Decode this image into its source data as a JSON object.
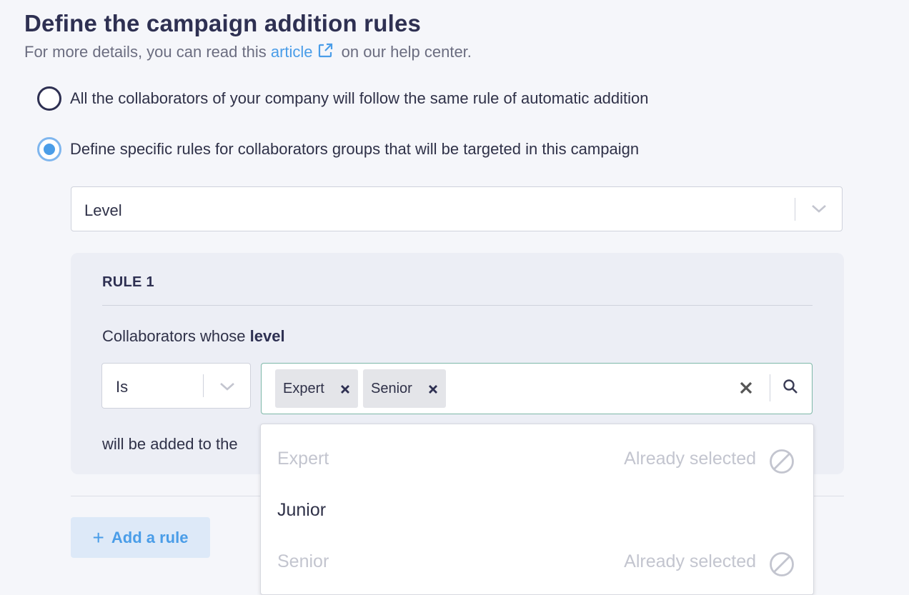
{
  "header": {
    "title": "Define the campaign addition rules",
    "subtitle_before": "For more details, you can read this",
    "link_text": "article",
    "subtitle_after": "on our help center."
  },
  "radios": {
    "same_rule_label": "All the collaborators of your company will follow the same rule of automatic addition",
    "specific_rules_label": "Define specific rules for collaborators groups that will be targeted in this campaign",
    "selected": "specific_rules"
  },
  "group_select": {
    "value": "Level"
  },
  "rule": {
    "title": "RULE 1",
    "collab_prefix": "Collaborators whose",
    "collab_field": "level",
    "operator": "Is",
    "chips": [
      "Expert",
      "Senior"
    ],
    "added_text": "will be added to the"
  },
  "dropdown": {
    "options": [
      {
        "label": "Expert",
        "note": "Already selected",
        "disabled": true
      },
      {
        "label": "Junior",
        "note": "",
        "disabled": false
      },
      {
        "label": "Senior",
        "note": "Already selected",
        "disabled": true
      }
    ]
  },
  "actions": {
    "add_rule_label": "Add a rule",
    "add_rule_icon": "+"
  },
  "colors": {
    "accent": "#4a9de8",
    "title": "#2e3052",
    "muted": "#c3c5cf"
  },
  "icons": [
    "external-link-icon",
    "chevron-down-icon",
    "close-icon",
    "search-icon",
    "ban-icon",
    "plus-icon"
  ]
}
